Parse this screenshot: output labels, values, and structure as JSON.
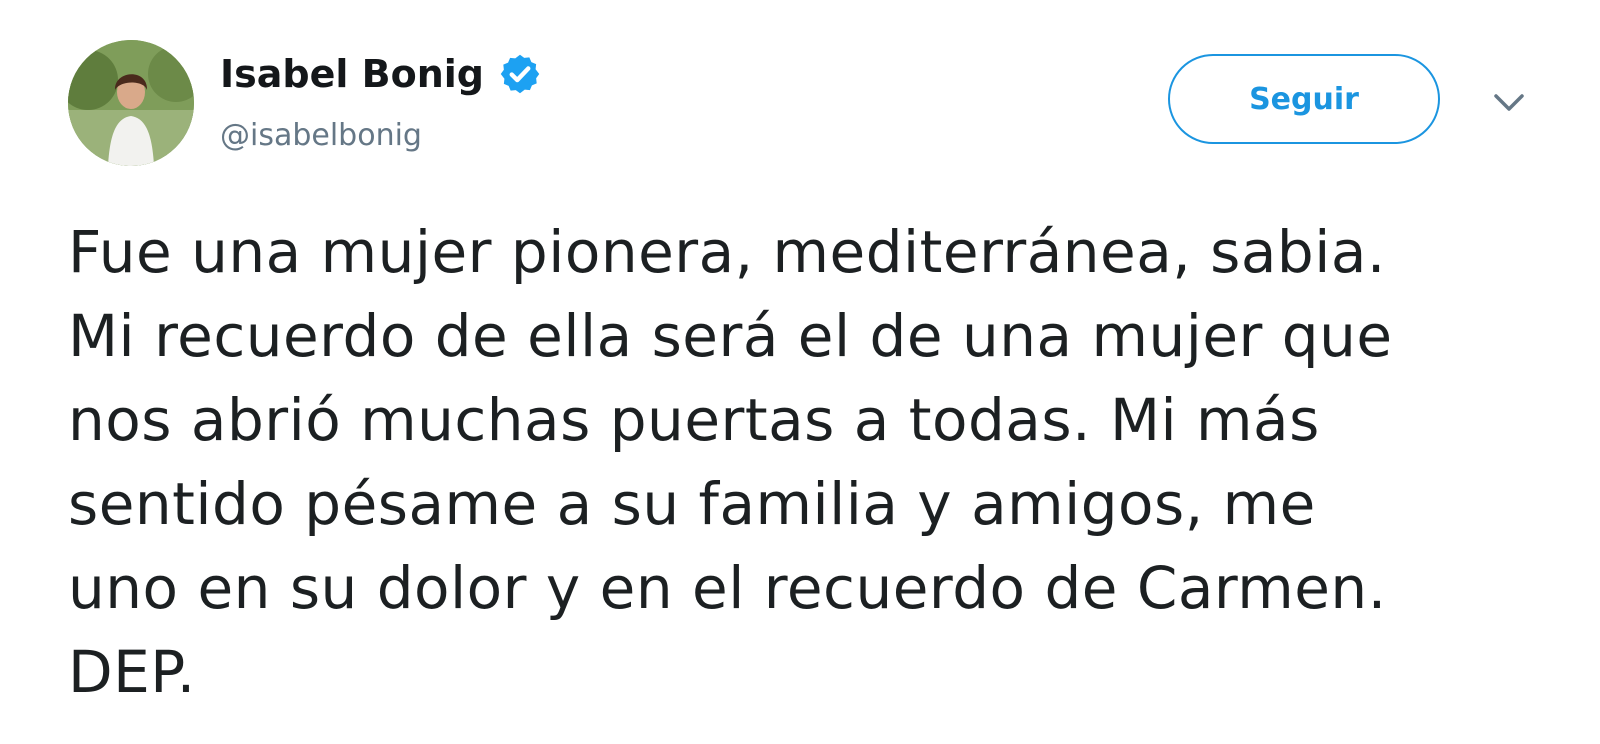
{
  "tweet": {
    "author": {
      "display_name": "Isabel Bonig",
      "handle": "@isabelbonig",
      "verified": true,
      "avatar_icon": "profile-photo"
    },
    "follow_label": "Seguir",
    "menu_icon": "chevron-down-icon",
    "text_lines": [
      "Fue una mujer pionera, mediterránea, sabia.",
      "Mi recuerdo de ella será el de una mujer que",
      "nos abrió muchas puertas a todas. Mi más",
      "sentido pésame a su familia y amigos, me",
      "uno en su dolor y en el recuerdo de Carmen.",
      "DEP."
    ]
  },
  "colors": {
    "accent": "#1b95e0",
    "text": "#1c2022",
    "muted": "#657786"
  }
}
